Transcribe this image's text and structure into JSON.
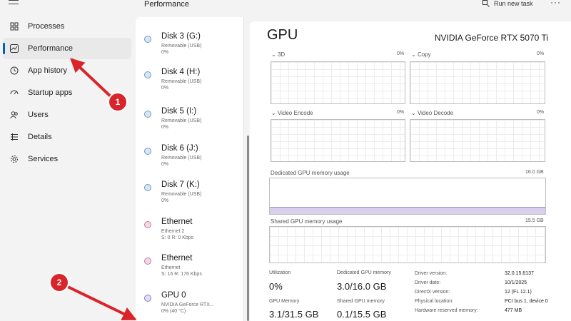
{
  "nav": {
    "items": [
      {
        "label": "Processes",
        "icon": "processes-grid-icon"
      },
      {
        "label": "Performance",
        "icon": "performance-chart-icon",
        "active": true
      },
      {
        "label": "App history",
        "icon": "history-clock-icon"
      },
      {
        "label": "Startup apps",
        "icon": "startup-gauge-icon"
      },
      {
        "label": "Users",
        "icon": "users-icon"
      },
      {
        "label": "Details",
        "icon": "details-list-icon"
      },
      {
        "label": "Services",
        "icon": "services-gear-icon"
      }
    ]
  },
  "header": {
    "title": "Performance",
    "run_task_label": "Run new task",
    "more_label": "···"
  },
  "devices": [
    {
      "name": "Disk 3 (G:)",
      "sub": "Removable (USB)",
      "sub2": "0%",
      "dot": "blue"
    },
    {
      "name": "Disk 4 (H:)",
      "sub": "Removable (USB)",
      "sub2": "0%",
      "dot": "blue"
    },
    {
      "name": "Disk 5 (I:)",
      "sub": "Removable (USB)",
      "sub2": "0%",
      "dot": "blue"
    },
    {
      "name": "Disk 6 (J:)",
      "sub": "Removable (USB)",
      "sub2": "0%",
      "dot": "blue"
    },
    {
      "name": "Disk 7 (K:)",
      "sub": "Removable (USB)",
      "sub2": "0%",
      "dot": "blue"
    },
    {
      "name": "Ethernet",
      "sub": "Ethernet 2",
      "sub2": "S: 0 R: 0 Kbps",
      "dot": "pink"
    },
    {
      "name": "Ethernet",
      "sub": "Ethernet",
      "sub2": "S: 16 R: 176 Kbps",
      "dot": "pink"
    },
    {
      "name": "GPU 0",
      "sub": "NVIDIA GeForce RTX...",
      "sub2": "0% (40 °C)",
      "dot": "purple"
    }
  ],
  "gpu": {
    "title": "GPU",
    "model": "NVIDIA GeForce RTX 5070 Ti",
    "graphs": [
      {
        "label": "3D",
        "pct": "0%"
      },
      {
        "label": "Copy",
        "pct": "0%"
      },
      {
        "label": "Video Encode",
        "pct": "0%"
      },
      {
        "label": "Video Decode",
        "pct": "0%"
      }
    ],
    "dedicated_memory_graph": {
      "label": "Dedicated GPU memory usage",
      "max": "16.0 GB",
      "usage_fraction": 0.19
    },
    "shared_memory_graph": {
      "label": "Shared GPU memory usage",
      "max": "15.5 GB",
      "usage_fraction": 0.0
    },
    "stats": [
      {
        "label": "Utilization",
        "value": "0%"
      },
      {
        "label": "Dedicated GPU memory",
        "value": "3.0/16.0 GB"
      },
      {
        "label": "GPU Memory",
        "value": "3.1/31.5 GB"
      },
      {
        "label": "Shared GPU memory",
        "value": "0.1/15.5 GB"
      }
    ],
    "specs": [
      {
        "k": "Driver version:",
        "v": "32.0.15.8137"
      },
      {
        "k": "Driver date:",
        "v": "10/1/2025"
      },
      {
        "k": "DirectX version:",
        "v": "12 (FL 12.1)"
      },
      {
        "k": "Physical location:",
        "v": "PCI bus 1, device 0"
      },
      {
        "k": "Hardware reserved memory:",
        "v": "477 MB"
      }
    ]
  },
  "annotations": {
    "badge1": "1",
    "badge2": "2",
    "color": "#d8242a"
  }
}
